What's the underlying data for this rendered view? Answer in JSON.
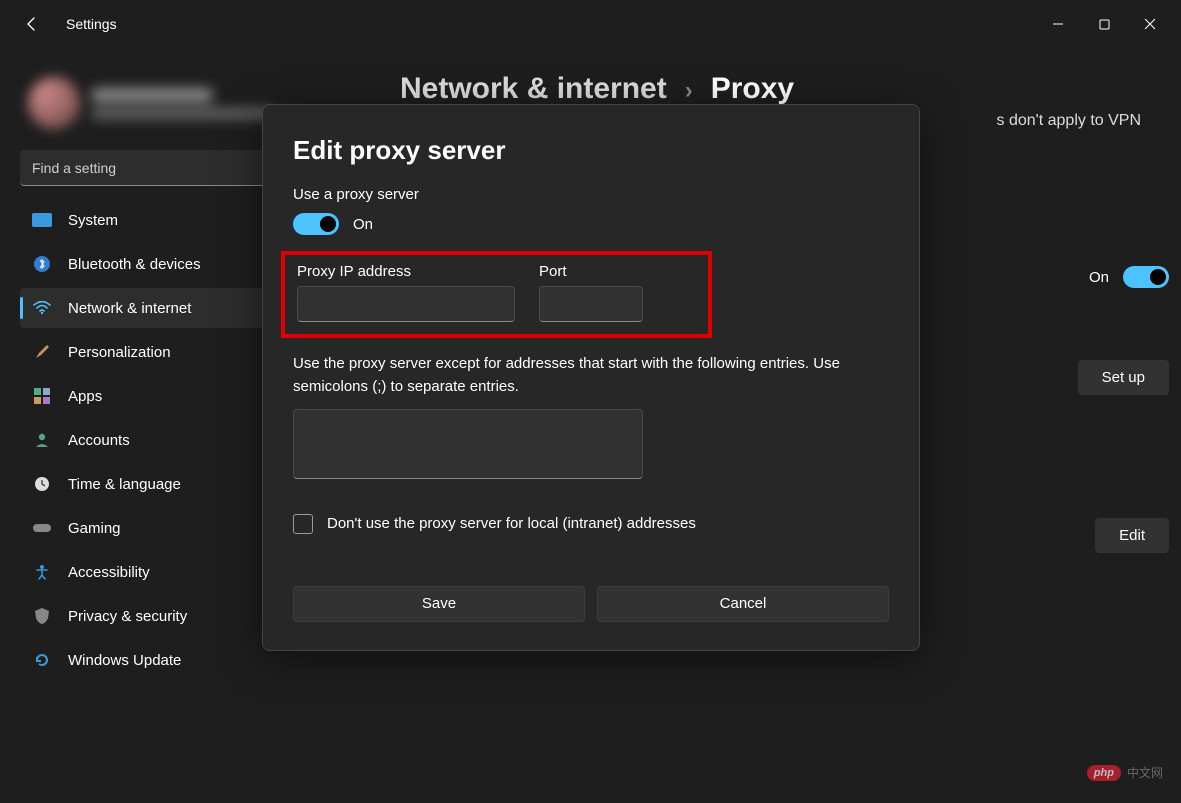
{
  "titlebar": {
    "app_title": "Settings"
  },
  "search": {
    "placeholder": "Find a setting"
  },
  "sidebar": {
    "items": [
      {
        "label": "System"
      },
      {
        "label": "Bluetooth & devices"
      },
      {
        "label": "Network & internet"
      },
      {
        "label": "Personalization"
      },
      {
        "label": "Apps"
      },
      {
        "label": "Accounts"
      },
      {
        "label": "Time & language"
      },
      {
        "label": "Gaming"
      },
      {
        "label": "Accessibility"
      },
      {
        "label": "Privacy & security"
      },
      {
        "label": "Windows Update"
      }
    ]
  },
  "breadcrumb": {
    "parent": "Network & internet",
    "current": "Proxy"
  },
  "background": {
    "note_fragment": "s don't apply to VPN",
    "auto_on": "On",
    "setup": "Set up",
    "edit": "Edit"
  },
  "dialog": {
    "title": "Edit proxy server",
    "use_proxy_label": "Use a proxy server",
    "toggle_state": "On",
    "ip_label": "Proxy IP address",
    "port_label": "Port",
    "ip_value": "",
    "port_value": "",
    "except_help": "Use the proxy server except for addresses that start with the following entries. Use semicolons (;) to separate entries.",
    "except_value": "",
    "dont_use_local": "Don't use the proxy server for local (intranet) addresses",
    "save": "Save",
    "cancel": "Cancel"
  },
  "watermark": {
    "pill": "php",
    "text": "中文网"
  }
}
